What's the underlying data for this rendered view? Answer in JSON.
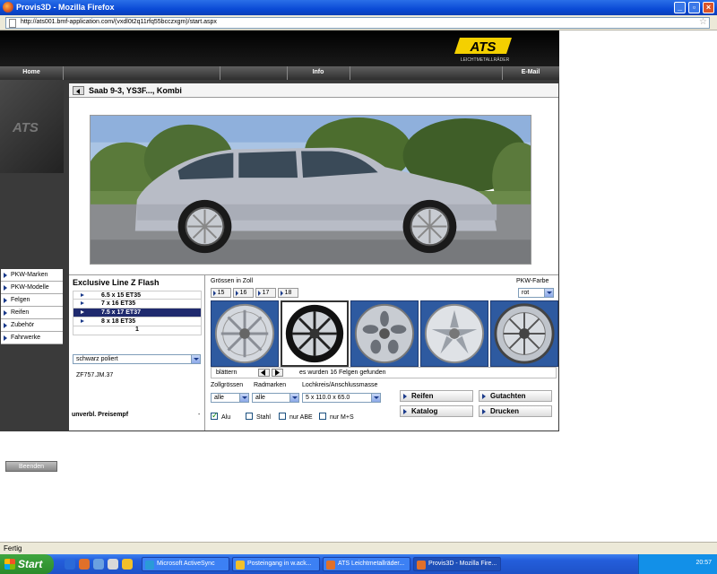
{
  "window": {
    "title": "Provis3D - Mozilla Firefox"
  },
  "browser": {
    "url": "http://ats001.bmf-application.com/(vxdl0t2q11rfq55bcczxgm)/start.aspx"
  },
  "brand": {
    "logo_text": "ATS",
    "logo_sub": "LEICHTMETALLRÄDER",
    "accent": "#f4d000"
  },
  "nav": {
    "home": "Home",
    "info": "Info",
    "email": "E-Mail"
  },
  "sidebar": {
    "logo_text": "ATS",
    "items": [
      {
        "label": "PKW-Marken"
      },
      {
        "label": "PKW-Modelle"
      },
      {
        "label": "Felgen"
      },
      {
        "label": "Reifen"
      },
      {
        "label": "Zubehör"
      },
      {
        "label": "Fahrwerke"
      }
    ],
    "logout_label": "Beenden"
  },
  "car": {
    "title": "Saab 9-3, YS3F..., Kombi"
  },
  "wheel": {
    "name": "Exclusive Line Z Flash",
    "sizes": [
      {
        "label": "6.5 x 15 ET35",
        "selected": false
      },
      {
        "label": "7 x 16 ET35",
        "selected": false
      },
      {
        "label": "7.5 x 17 ET37",
        "selected": true
      },
      {
        "label": "8 x 18 ET35",
        "selected": false
      }
    ],
    "page": "1",
    "color": "schwarz poliert",
    "article_no": "ZF757.JM.37",
    "price_label": "unverbl. Preisempf",
    "price_value": "-"
  },
  "filters": {
    "sizes_label": "Grössen in Zoll",
    "sizes": [
      "15",
      "16",
      "17",
      "18"
    ],
    "car_color_label": "PKW-Farbe",
    "car_color": "rot",
    "pager_label": "blättern",
    "found_text": "es wurden 16 Felgen gefunden",
    "zoll_label": "Zollgrössen",
    "zoll_value": "alle",
    "radmarken_label": "Radmarken",
    "radmarken_value": "alle",
    "lochkreis_label": "Lochkreis/Anschlussmasse",
    "lochkreis_value": "5 x 110.0 x 65.0",
    "checks": [
      {
        "label": "Alu",
        "checked": true
      },
      {
        "label": "Stahl",
        "checked": false
      },
      {
        "label": "nur ABE",
        "checked": false
      },
      {
        "label": "nur M+S",
        "checked": false
      }
    ]
  },
  "actions": {
    "reifen": "Reifen",
    "gutachten": "Gutachten",
    "katalog": "Katalog",
    "drucken": "Drucken"
  },
  "status": {
    "text": "Fertig"
  },
  "taskbar": {
    "start": "Start",
    "tasks": [
      {
        "label": "Microsoft ActiveSync"
      },
      {
        "label": "Posteingang in w.ack..."
      },
      {
        "label": "ATS Leichtmetallräder..."
      },
      {
        "label": "Provis3D - Mozilla Fire..."
      }
    ],
    "clock": "20:57"
  }
}
